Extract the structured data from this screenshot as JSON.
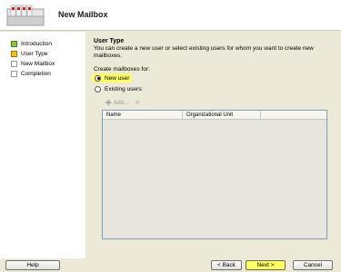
{
  "window": {
    "title": "New Mailbox"
  },
  "nav": {
    "items": [
      {
        "label": "Introduction",
        "state": "done"
      },
      {
        "label": "User Type",
        "state": "current"
      },
      {
        "label": "New Mailbox",
        "state": "todo"
      },
      {
        "label": "Completion",
        "state": "todo"
      }
    ]
  },
  "section": {
    "title": "User Type",
    "description": "You can create a new user or select existing users for whom you want to create new mailboxes.",
    "create_label": "Create mailboxes for:"
  },
  "options": {
    "new_user": "New user",
    "existing_users": "Existing users:",
    "selected": "new_user"
  },
  "toolbar": {
    "add_label": "Add...",
    "add_icon": "plus-icon",
    "remove_icon": "remove-icon"
  },
  "grid": {
    "columns": [
      "Name",
      "Organizational Unit"
    ],
    "rows": []
  },
  "buttons": {
    "help": "Help",
    "back": "< Back",
    "next": "Next >",
    "cancel": "Cancel"
  },
  "colors": {
    "highlight": "#ffff66",
    "done": "#8fc04a",
    "current": "#f2c11a"
  }
}
